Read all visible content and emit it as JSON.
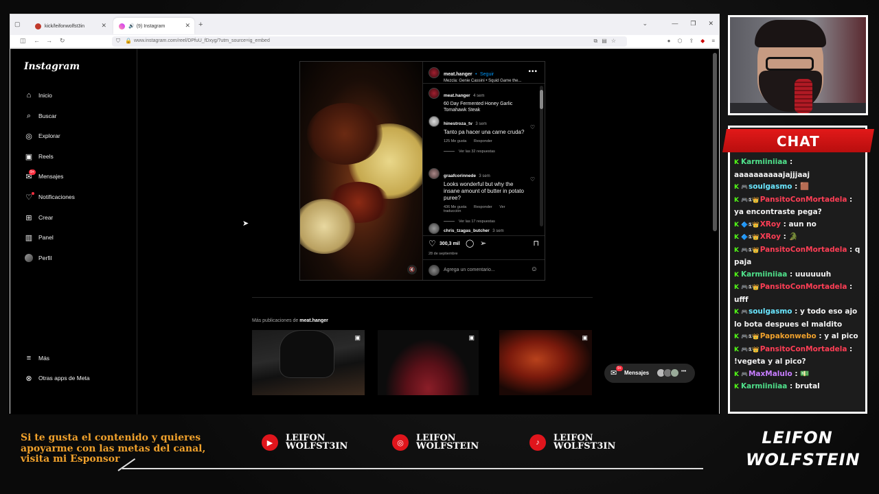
{
  "browser": {
    "tabs": [
      {
        "title": "kick/leifonwolfst3in",
        "active": false
      },
      {
        "title": "(9) Instagram",
        "active": true
      }
    ],
    "new_tab": "+",
    "url": "www.instagram.com/reel/DPfuU_fDxyg/?utm_source=ig_embed"
  },
  "instagram": {
    "logo": "Instagram",
    "sidebar": [
      {
        "label": "Inicio",
        "icon": "home-icon"
      },
      {
        "label": "Buscar",
        "icon": "search-icon"
      },
      {
        "label": "Explorar",
        "icon": "compass-icon"
      },
      {
        "label": "Reels",
        "icon": "reels-icon"
      },
      {
        "label": "Mensajes",
        "icon": "messages-icon",
        "badge": "9+"
      },
      {
        "label": "Notificaciones",
        "icon": "heart-icon"
      },
      {
        "label": "Crear",
        "icon": "plus-icon"
      },
      {
        "label": "Panel",
        "icon": "panel-icon"
      },
      {
        "label": "Perfil",
        "icon": "avatar"
      },
      {
        "label": "Más",
        "icon": "menu-icon"
      },
      {
        "label": "Otras apps de Meta",
        "icon": "meta-apps-icon"
      }
    ],
    "post": {
      "username": "meat.hanger",
      "follow": "Seguir",
      "audio": "Mezcla: Genie Cassini • Squid Game the...",
      "likes": "300,3 mil",
      "date": "28 de septiembre",
      "comment_placeholder": "Agrega un comentario...",
      "comments": [
        {
          "user": "meat.hanger",
          "time": "4 sem",
          "text": "60 Day Fermented Honey Garlic Tomahawk Steak",
          "likes": "",
          "reply": "",
          "translate": "",
          "replies": ""
        },
        {
          "user": "hinestroza_tv",
          "time": "3 sem",
          "text": "Tanto pa hacer una carne cruda?",
          "likes": "125 Me gusta",
          "reply": "Responder",
          "translate": "",
          "replies": "Ver las 32 respuestas"
        },
        {
          "user": "graafcorinnede",
          "time": "3 sem",
          "text": "Looks wonderful but why the insane amount of butter in potato puree?",
          "likes": "436 Me gusta",
          "reply": "Responder",
          "translate": "Ver traducción",
          "replies": "Ver las 17 respuestas"
        },
        {
          "user": "chris_tzagas_butcher",
          "time": "3 sem",
          "text": "",
          "likes": "",
          "reply": "",
          "translate": "",
          "replies": ""
        }
      ]
    },
    "more_posts": {
      "prefix": "Más publicaciones de",
      "user": "meat.hanger"
    },
    "messages_pill": {
      "label": "Mensajes",
      "badge": "9+"
    }
  },
  "chat": {
    "title": "CHAT",
    "messages": [
      {
        "user": "Karmiiniiaa",
        "color": "#4fe08a",
        "badges": "",
        "text": "aaaaaaaaaajajjjaaj"
      },
      {
        "user": "soulgasmo",
        "color": "#69e6ff",
        "badges": "🎮",
        "text": "🟫"
      },
      {
        "user": "PansitoConMortadela",
        "color": "#ff3e55",
        "badges": "🎮①👑",
        "text": "ya encontraste pega?"
      },
      {
        "user": "XRoy",
        "color": "#ff3e55",
        "badges": "🔷①👑",
        "text": "aun no"
      },
      {
        "user": "XRoy",
        "color": "#ff3e55",
        "badges": "🔷①👑",
        "text": "🐊"
      },
      {
        "user": "PansitoConMortadela",
        "color": "#ff3e55",
        "badges": "🎮①👑",
        "text": "q paja"
      },
      {
        "user": "Karmiiniiaa",
        "color": "#4fe08a",
        "badges": "",
        "text": "uuuuuuh"
      },
      {
        "user": "PansitoConMortadela",
        "color": "#ff3e55",
        "badges": "🎮①👑",
        "text": "ufff"
      },
      {
        "user": "soulgasmo",
        "color": "#69e6ff",
        "badges": "🎮",
        "text": "y todo eso ajo lo bota despues el maldito"
      },
      {
        "user": "Papakonwebo",
        "color": "#f0a12c",
        "badges": "🎮①👑",
        "text": "y al pico"
      },
      {
        "user": "PansitoConMortadela",
        "color": "#ff3e55",
        "badges": "🎮①👑",
        "text": "!vegeta y al pico?"
      },
      {
        "user": "MaxMalulo",
        "color": "#c77dff",
        "badges": "🎮",
        "text": "💵"
      },
      {
        "user": "Karmiiniiaa",
        "color": "#4fe08a",
        "badges": "",
        "text": "brutal"
      }
    ]
  },
  "footer": {
    "promo": "Si te gusta el contenido y quieres apoyarme con las metas del canal, visita mi Esponsor",
    "socials": [
      {
        "platform": "youtube-icon",
        "line1": "LEIFON",
        "line2": "WOLFST3IN"
      },
      {
        "platform": "instagram-icon",
        "line1": "LEIFON",
        "line2": "WOLFSTEIN"
      },
      {
        "platform": "tiktok-icon",
        "line1": "LEIFON",
        "line2": "WOLFST3IN"
      }
    ],
    "logo_top": "LEIFON",
    "logo_bottom": "WOLFSTEIN"
  },
  "colors": {
    "accent_red": "#e21919",
    "promo_orange": "#f0a12c",
    "ig_blue": "#0095f6"
  }
}
